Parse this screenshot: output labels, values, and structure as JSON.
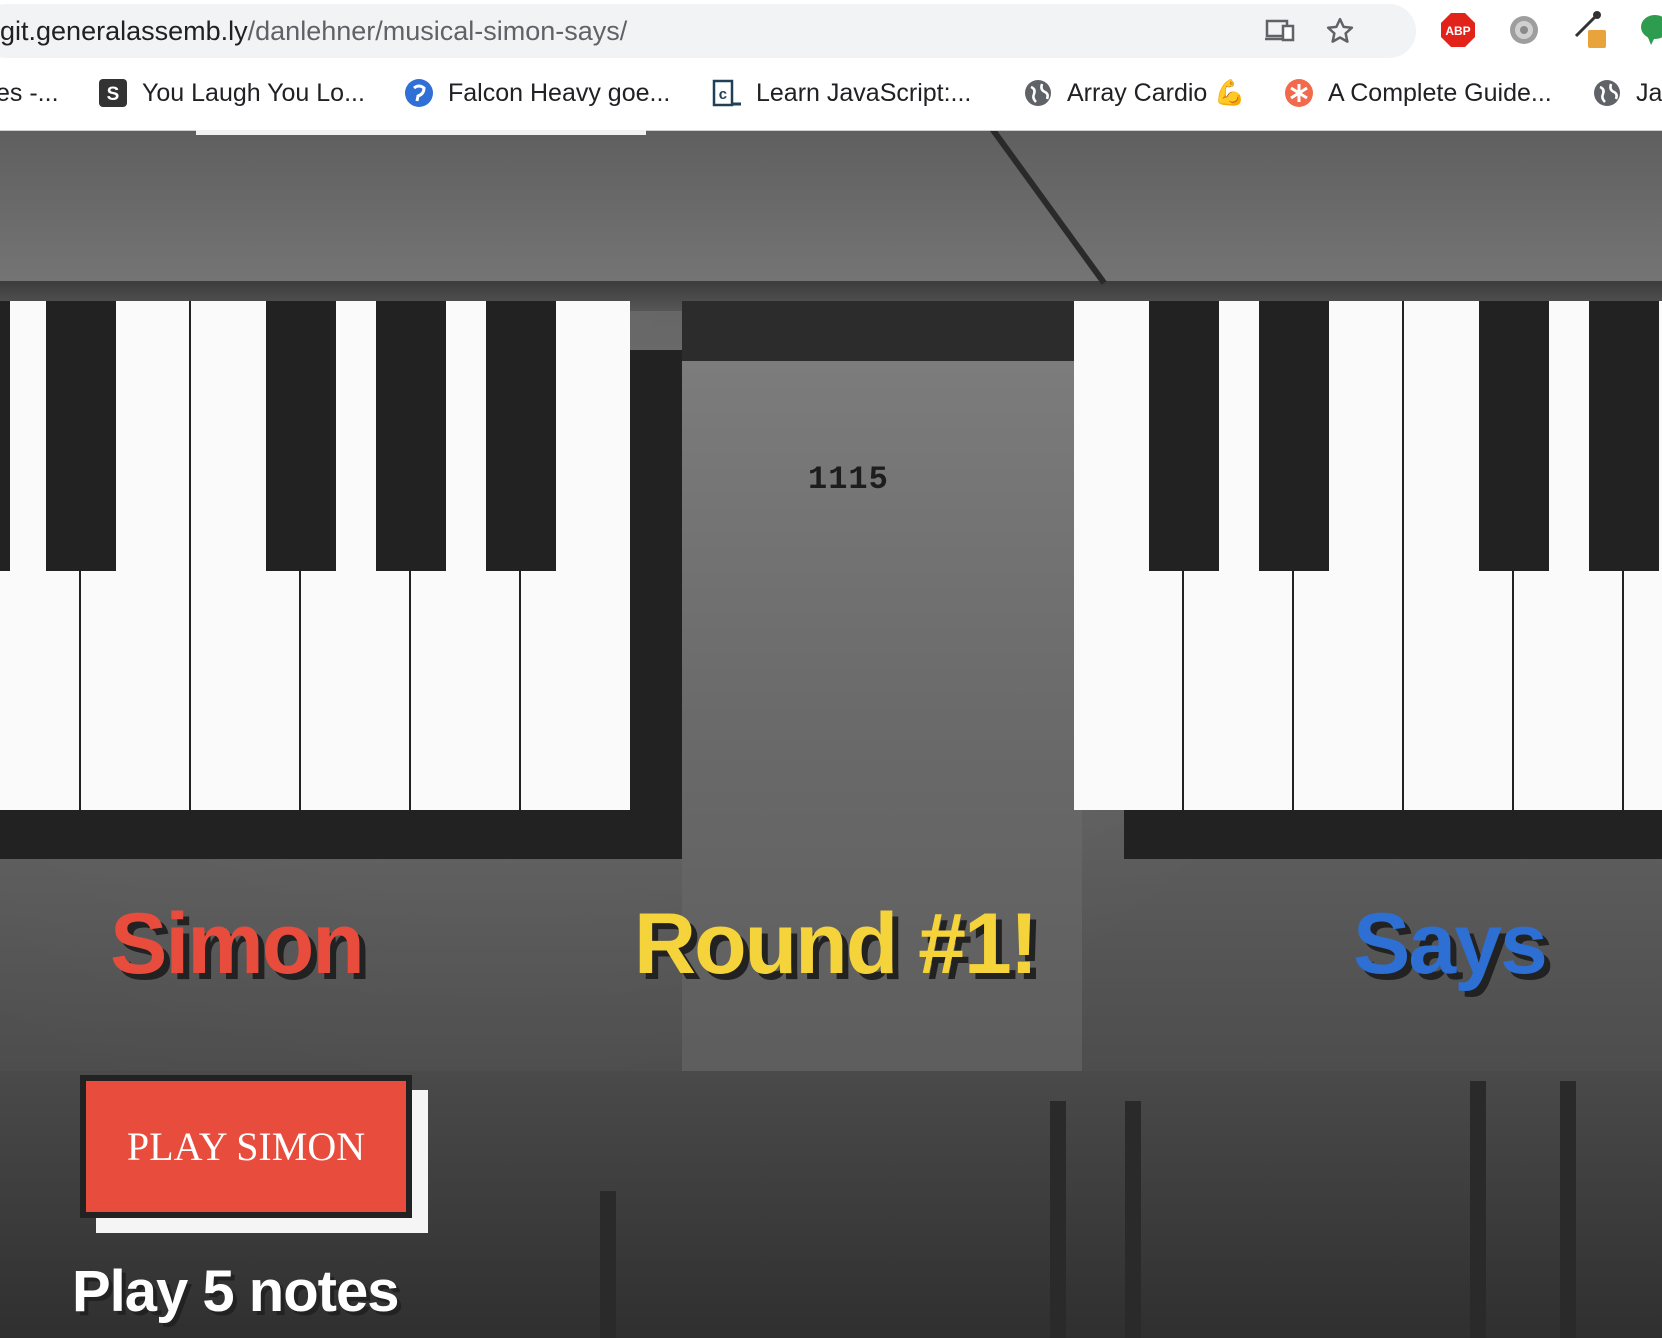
{
  "browser": {
    "url_host": "git.generalassemb.ly",
    "url_path": "/danlehner/musical-simon-says/",
    "bookmarks": [
      {
        "label": "es -...",
        "icon": "none"
      },
      {
        "label": "You Laugh You Lo...",
        "icon": "s-icon"
      },
      {
        "label": "Falcon Heavy goe...",
        "icon": "blue-circle-icon"
      },
      {
        "label": "Learn JavaScript:...",
        "icon": "codecademy-icon"
      },
      {
        "label": "Array Cardio 💪",
        "icon": "globe-icon"
      },
      {
        "label": "A Complete Guide...",
        "icon": "asterisk-icon"
      },
      {
        "label": "Ja",
        "icon": "globe-icon"
      }
    ],
    "extensions": [
      "abp-icon",
      "gear-icon",
      "eyedropper-icon",
      "chat-bubble-icon"
    ],
    "abp_text": "ABP"
  },
  "page": {
    "serial_text": "1115",
    "title_left": "Simon",
    "title_center": "Round #1!",
    "title_right": "Says",
    "button_label": "PLAY SIMON",
    "notes_text": "Play 5 notes",
    "colors": {
      "red": "#e84c3d",
      "yellow": "#f5d33b",
      "blue": "#2d6fd2",
      "dark": "#222222",
      "white_key": "#fafafa"
    }
  }
}
